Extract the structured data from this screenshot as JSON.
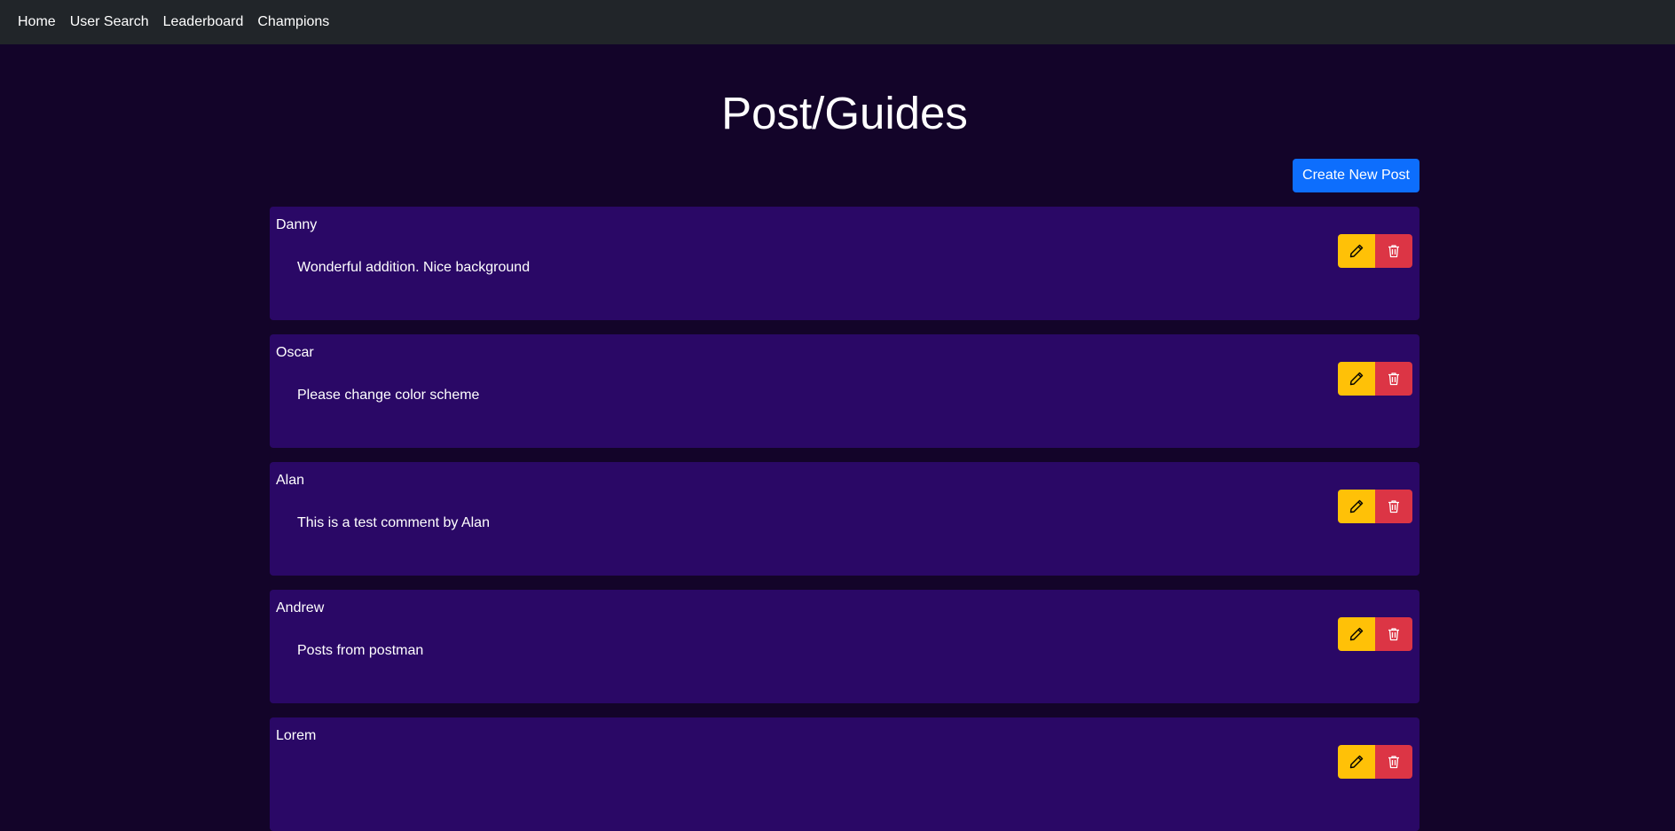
{
  "nav": {
    "items": [
      {
        "label": "Home"
      },
      {
        "label": "User Search"
      },
      {
        "label": "Leaderboard"
      },
      {
        "label": "Champions"
      }
    ]
  },
  "page": {
    "title": "Post/Guides",
    "create_button_label": "Create New Post"
  },
  "posts": [
    {
      "author": "Danny",
      "body": "Wonderful addition. Nice background"
    },
    {
      "author": "Oscar",
      "body": "Please change color scheme"
    },
    {
      "author": "Alan",
      "body": "This is a test comment by Alan"
    },
    {
      "author": "Andrew",
      "body": "Posts from postman"
    },
    {
      "author": "Lorem",
      "body": ""
    }
  ],
  "icons": {
    "edit": "pencil-icon",
    "delete": "trash-icon"
  },
  "colors": {
    "navbar": "#212529",
    "background": "#130429",
    "card": "#2a0866",
    "primary": "#0d6efd",
    "warning": "#ffc107",
    "danger": "#dc3545"
  }
}
